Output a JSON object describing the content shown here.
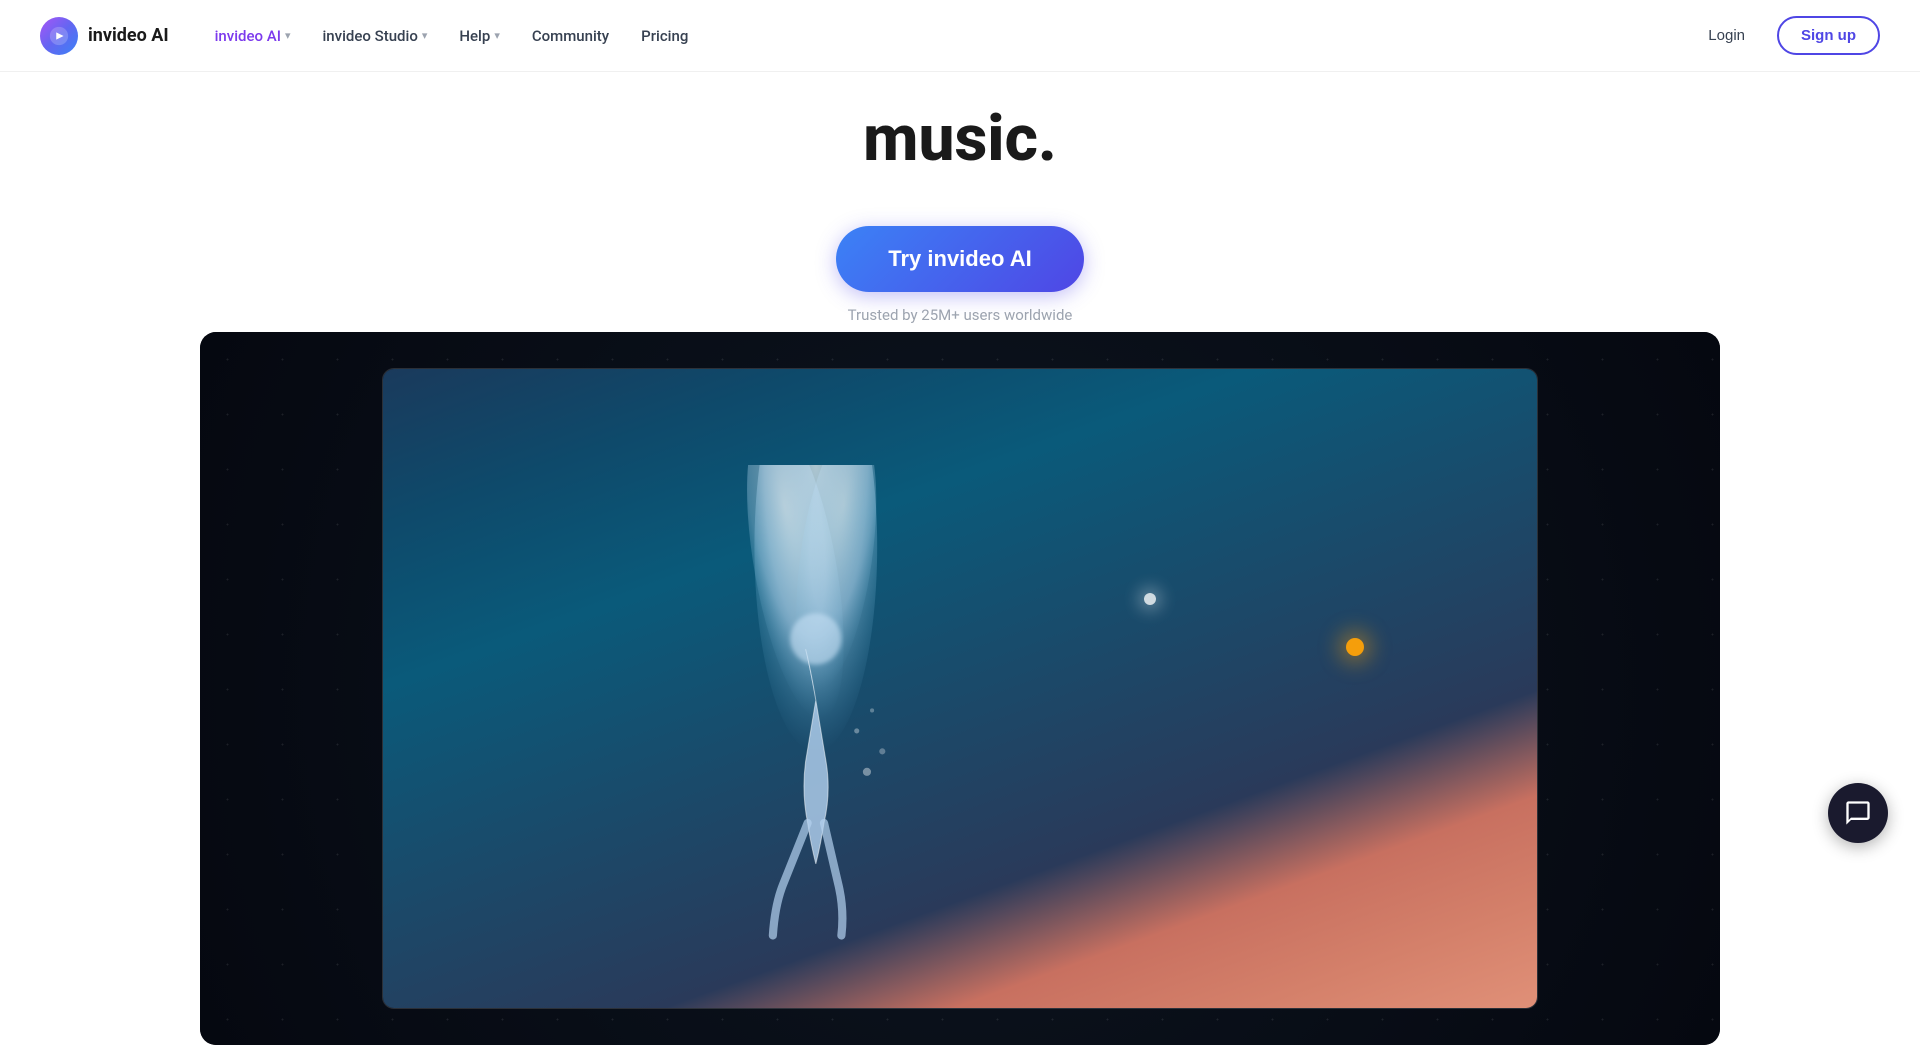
{
  "nav": {
    "logo_text": "invideo AI",
    "links": [
      {
        "id": "invideo-ai",
        "label": "invideo AI",
        "has_dropdown": true,
        "active": true
      },
      {
        "id": "invideo-studio",
        "label": "invideo Studio",
        "has_dropdown": true,
        "active": false
      },
      {
        "id": "help",
        "label": "Help",
        "has_dropdown": true,
        "active": false
      },
      {
        "id": "community",
        "label": "Community",
        "has_dropdown": false,
        "active": false
      },
      {
        "id": "pricing",
        "label": "Pricing",
        "has_dropdown": false,
        "active": false
      }
    ],
    "login_label": "Login",
    "signup_label": "Sign up"
  },
  "hero": {
    "title_line": "music.",
    "cta_button": "Try invideo AI",
    "trust_text": "Trusted by 25M+ users worldwide"
  },
  "colors": {
    "accent_purple": "#7c3aed",
    "accent_blue": "#4f46e5",
    "cta_gradient_start": "#3b82f6",
    "cta_gradient_end": "#4f46e5"
  }
}
